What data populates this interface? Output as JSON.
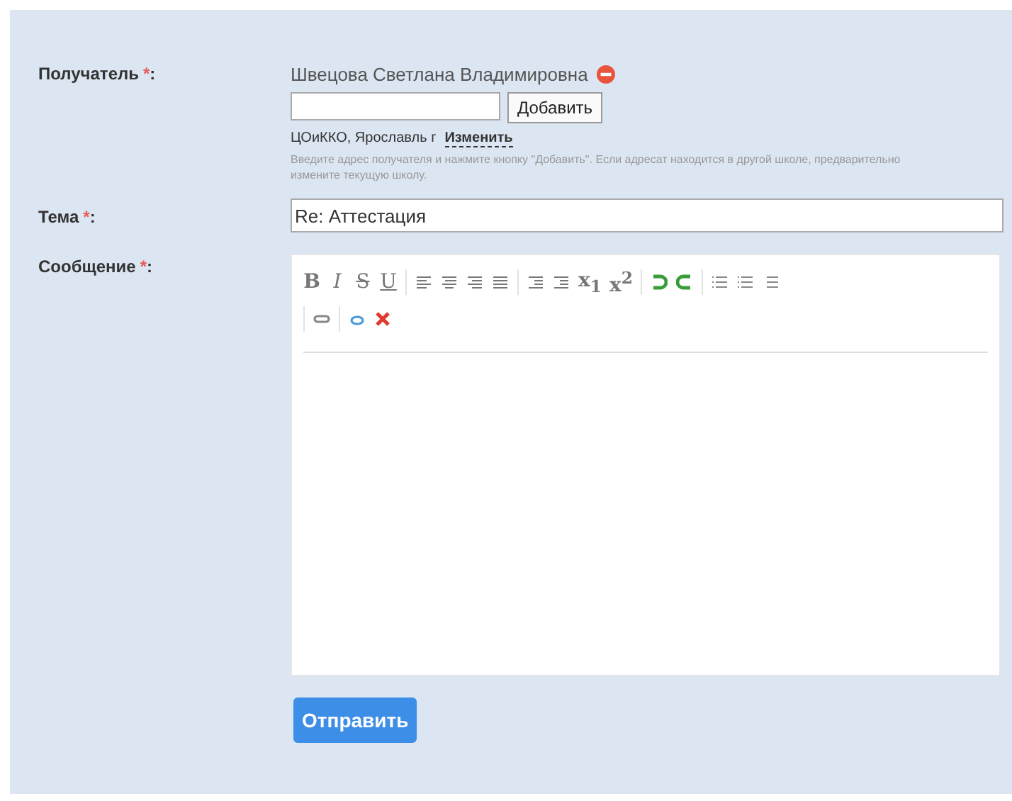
{
  "recipient": {
    "label": "Получатель",
    "required_mark": "*",
    "colon": ":",
    "name": "Швецова Светлана Владимировна",
    "add_button": "Добавить",
    "school": "ЦОиККО, Ярославль г",
    "change_link": "Изменить",
    "hint": "Введите адрес получателя и нажмите кнопку \"Добавить\". Если адресат находится в другой школе, предварительно измените текущую школу."
  },
  "subject": {
    "label": "Тема",
    "required_mark": "*",
    "colon": ":",
    "value": "Re: Аттестация"
  },
  "message": {
    "label": "Сообщение",
    "required_mark": "*",
    "colon": ":",
    "format_buttons": [
      "B",
      "I",
      "S",
      "U"
    ],
    "script_buttons": [
      "x$_{1}$",
      "x$^{2}$"
    ]
  },
  "send_button": "Отправить"
}
